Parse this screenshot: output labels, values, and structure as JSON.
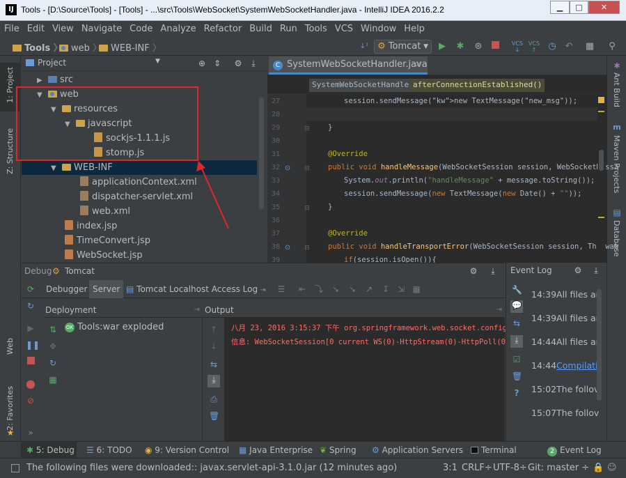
{
  "window": {
    "title": "Tools - [D:\\Source\\Tools] - [Tools] - ...\\src\\Tools\\WebSocket\\SystemWebSocketHandler.java - IntelliJ IDEA 2016.2.2",
    "app_icon": "IJ",
    "min": "▁",
    "max": "□",
    "close": "✕"
  },
  "menu": [
    "File",
    "Edit",
    "View",
    "Navigate",
    "Code",
    "Analyze",
    "Refactor",
    "Build",
    "Run",
    "Tools",
    "VCS",
    "Window",
    "Help"
  ],
  "navbar": {
    "crumbs": [
      "Tools",
      "web",
      "WEB-INF"
    ],
    "run_config": "Tomcat"
  },
  "left_strip": {
    "project": "1: Project",
    "structure": "Z: Structure",
    "web": "Web",
    "favorites": "2: Favorites"
  },
  "right_strip": {
    "ant": "Ant Build",
    "maven": "Maven Projects",
    "database": "Database"
  },
  "project_panel": {
    "title": "Project",
    "tree": [
      {
        "label": "src",
        "indent": 0,
        "arrow": "▶",
        "icon": "src"
      },
      {
        "label": "web",
        "indent": 0,
        "arrow": "▼",
        "icon": "folder-mod"
      },
      {
        "label": "resources",
        "indent": 1,
        "arrow": "▼",
        "icon": "folder"
      },
      {
        "label": "javascript",
        "indent": 2,
        "arrow": "▼",
        "icon": "folder"
      },
      {
        "label": "sockjs-1.1.1.js",
        "indent": 3,
        "arrow": "",
        "icon": "js"
      },
      {
        "label": "stomp.js",
        "indent": 3,
        "arrow": "",
        "icon": "js"
      },
      {
        "label": "WEB-INF",
        "indent": 1,
        "arrow": "▼",
        "icon": "folder",
        "selected": true
      },
      {
        "label": "applicationContext.xml",
        "indent": 2,
        "arrow": "",
        "icon": "xml"
      },
      {
        "label": "dispatcher-servlet.xml",
        "indent": 2,
        "arrow": "",
        "icon": "xml"
      },
      {
        "label": "web.xml",
        "indent": 2,
        "arrow": "",
        "icon": "xml"
      },
      {
        "label": "index.jsp",
        "indent": 1,
        "arrow": "",
        "icon": "jsp"
      },
      {
        "label": "TimeConvert.jsp",
        "indent": 1,
        "arrow": "",
        "icon": "jsp"
      },
      {
        "label": "WebSocket.jsp",
        "indent": 1,
        "arrow": "",
        "icon": "jsp"
      }
    ]
  },
  "editor": {
    "tab": "SystemWebSocketHandler.java",
    "crumb_class": "SystemWebSocketHandler",
    "crumb_method": "afterConnectionEstablished()",
    "lines": [
      "27",
      "28",
      "29",
      "30",
      "31",
      "32",
      "33",
      "34",
      "35",
      "36",
      "37",
      "38",
      "39"
    ],
    "code": {
      "l27": "session.sendMessage(new TextMessage(\"new_msg\"));",
      "l29": "}",
      "l31": "@Override",
      "l32": "public void handleMessage(WebSocketSession session, WebSocketMessa",
      "l33": "System.out.println(\"handleMessage\" + message.toString());",
      "l34": "session.sendMessage(new TextMessage(new Date() + \"\"));",
      "l35": "}",
      "l37": "@Override",
      "l38": "public void handleTransportError(WebSocketSession session, Throwab",
      "l39": "if(session.isOpen()){"
    }
  },
  "debug": {
    "title": "Debug",
    "config": "Tomcat",
    "tabs": [
      "Debugger",
      "Server",
      "Tomcat Localhost Access Log"
    ],
    "deployment_header": "Deployment",
    "deployment_item": "Tools:war exploded",
    "output_header": "Output",
    "output_lines": [
      "八月 23, 2016 3:15:37 下午 org.springframework.web.socket.config.",
      "信息: WebSocketSession[0 current WS(0)-HttpStream(0)-HttpPoll(0),"
    ]
  },
  "event_log": {
    "title": "Event Log",
    "entries": [
      {
        "time": "14:39",
        "text": "All files ar"
      },
      {
        "time": "14:39",
        "text": "All files ar"
      },
      {
        "time": "14:44",
        "text": "All files ar"
      },
      {
        "time": "14:44",
        "text": "Compilati"
      },
      {
        "time": "15:02",
        "text": "The follov"
      },
      {
        "time": "15:07",
        "text": "The follov"
      }
    ]
  },
  "tool_tabs": [
    {
      "label": "5: Debug"
    },
    {
      "label": "6: TODO"
    },
    {
      "label": "9: Version Control"
    },
    {
      "label": "Java Enterprise"
    },
    {
      "label": "Spring"
    },
    {
      "label": "Application Servers"
    },
    {
      "label": "Terminal"
    },
    {
      "label": "Event Log",
      "badge": "2"
    }
  ],
  "status": {
    "message": "The following files were downloaded:: javax.servlet-api-3.1.0.jar (12 minutes ago)",
    "position": "3:1",
    "line_sep": "CRLF÷",
    "encoding": "UTF-8÷",
    "git": "Git: master ÷"
  },
  "colors": {
    "accent": "#4a88c7",
    "highlight_box": "#e0282b",
    "error_text": "#ff6b68"
  }
}
